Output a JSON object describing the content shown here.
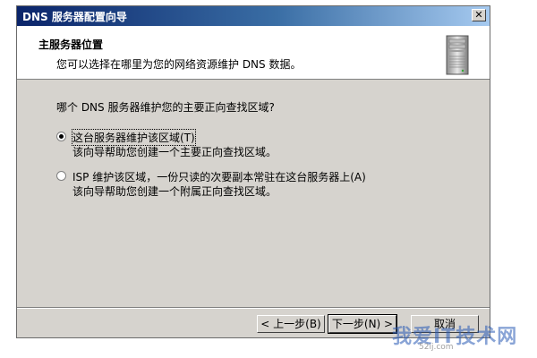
{
  "window": {
    "title": "DNS 服务器配置向导",
    "close_glyph": "✕"
  },
  "header": {
    "title": "主服务器位置",
    "subtitle": "您可以选择在哪里为您的网络资源维护 DNS 数据。",
    "icon": "server-tower-icon"
  },
  "body": {
    "question": "哪个 DNS 服务器维护您的主要正向查找区域?",
    "options": [
      {
        "label": "这台服务器维护该区域(T)",
        "description": "该向导帮助您创建一个主要正向查找区域。",
        "selected": true
      },
      {
        "label": "ISP 维护该区域，一份只读的次要副本常驻在这台服务器上(A)",
        "description": "该向导帮助您创建一个附属正向查找区域。",
        "selected": false
      }
    ]
  },
  "buttons": {
    "back": "< 上一步(B)",
    "next": "下一步(N) >",
    "cancel": "取消"
  },
  "watermark": {
    "brand": "我爱IT技术网",
    "url": "52ij.com"
  },
  "colors": {
    "titlebar_start": "#0a246a",
    "titlebar_end": "#a6caf0",
    "dialog_bg": "#d6d3ce"
  }
}
